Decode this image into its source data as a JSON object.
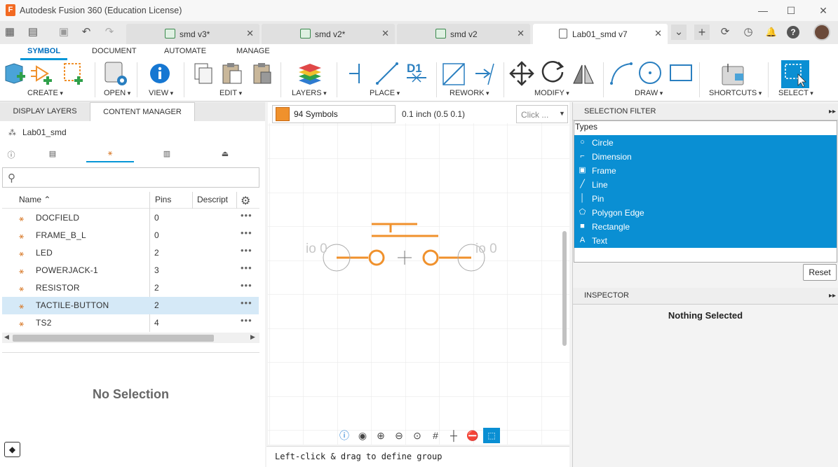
{
  "window": {
    "title": "Autodesk Fusion 360 (Education License)",
    "logo_letter": "F",
    "minimize": "—",
    "maximize": "☐",
    "close": "✕"
  },
  "tabs": [
    {
      "label": "smd v3*",
      "close": "✕"
    },
    {
      "label": "smd v2*",
      "close": "✕"
    },
    {
      "label": "smd v2",
      "close": "✕"
    },
    {
      "label": "Lab01_smd v7",
      "close": "✕"
    }
  ],
  "quick": {
    "grid": "▦",
    "file": "▤",
    "save": "▣",
    "undo": "↶",
    "redo": "↷",
    "more": "⌄",
    "add": "+",
    "refresh": "⟳",
    "clock": "◷",
    "bell": "🔔",
    "help": "?"
  },
  "ribbon": {
    "tabs": [
      "SYMBOL",
      "DOCUMENT",
      "AUTOMATE",
      "MANAGE"
    ],
    "groups": [
      "CREATE",
      "OPEN",
      "VIEW",
      "EDIT",
      "LAYERS",
      "PLACE",
      "REWORK",
      "MODIFY",
      "DRAW",
      "SHORTCUTS",
      "SELECT"
    ],
    "place_d1": "D1"
  },
  "left_panel": {
    "tabs": [
      "DISPLAY LAYERS",
      "CONTENT MANAGER"
    ],
    "library": "Lab01_smd",
    "search_placeholder": "",
    "columns": [
      "Name",
      "Pins",
      "Descript"
    ],
    "rows": [
      {
        "name": "DOCFIELD",
        "pins": "0"
      },
      {
        "name": "FRAME_B_L",
        "pins": "0"
      },
      {
        "name": "LED",
        "pins": "2"
      },
      {
        "name": "POWERJACK-1",
        "pins": "3"
      },
      {
        "name": "RESISTOR",
        "pins": "2"
      },
      {
        "name": "TACTILE-BUTTON",
        "pins": "2"
      },
      {
        "name": "TS2",
        "pins": "4"
      }
    ],
    "selected_row": "TACTILE-BUTTON",
    "no_selection": "No Selection"
  },
  "canvas": {
    "symbol_count": "94 Symbols",
    "grid_info": "0.1 inch (0.5 0.1)",
    "click_placeholder": "Click ...",
    "pin_label_left": "io 0",
    "pin_label_right": "io 0",
    "symbol_color": "#f0912c",
    "status": "Left-click & drag to define group"
  },
  "selection_filter": {
    "title": "SELECTION FILTER",
    "types_label": "Types",
    "types": [
      {
        "label": "Circle",
        "icon": "circle-icon",
        "glyph": "○"
      },
      {
        "label": "Dimension",
        "icon": "dimension-icon",
        "glyph": "⌐"
      },
      {
        "label": "Frame",
        "icon": "frame-icon",
        "glyph": "▣"
      },
      {
        "label": "Line",
        "icon": "line-icon",
        "glyph": "╱"
      },
      {
        "label": "Pin",
        "icon": "pin-icon",
        "glyph": "│"
      },
      {
        "label": "Polygon Edge",
        "icon": "polygon-edge-icon",
        "glyph": "⬠"
      },
      {
        "label": "Rectangle",
        "icon": "rectangle-icon",
        "glyph": "■"
      },
      {
        "label": "Text",
        "icon": "text-icon",
        "glyph": "A"
      }
    ],
    "reset": "Reset",
    "highlight_color": "#0a8fd3"
  },
  "inspector": {
    "title": "INSPECTOR",
    "status": "Nothing Selected"
  }
}
